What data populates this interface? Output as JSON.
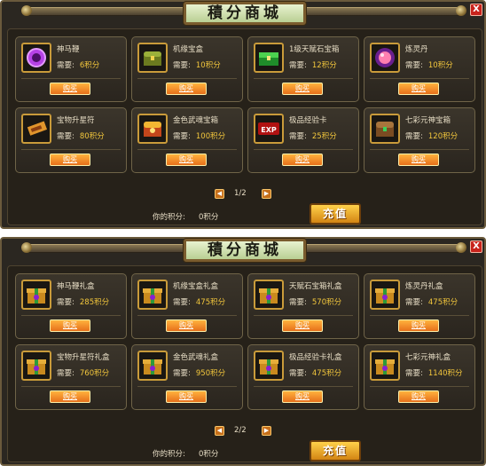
{
  "panels": [
    {
      "title": "積分商城",
      "close_label": "X",
      "items": [
        {
          "name": "神马鞭",
          "cost_label": "需要:",
          "cost": "6积分",
          "buy": "购买",
          "icon": "purple-ring-icon"
        },
        {
          "name": "机缘宝盒",
          "cost_label": "需要:",
          "cost": "10积分",
          "buy": "购买",
          "icon": "treasure-chest-icon"
        },
        {
          "name": "1级天赋石宝箱",
          "cost_label": "需要:",
          "cost": "12积分",
          "buy": "购买",
          "icon": "green-chest-icon"
        },
        {
          "name": "炼灵丹",
          "cost_label": "需要:",
          "cost": "10积分",
          "buy": "购买",
          "icon": "pink-pill-icon"
        },
        {
          "name": "宝物升星符",
          "cost_label": "需要:",
          "cost": "80积分",
          "buy": "购买",
          "icon": "talisman-icon"
        },
        {
          "name": "金色武魂宝箱",
          "cost_label": "需要:",
          "cost": "100积分",
          "buy": "购买",
          "icon": "gold-chest-icon"
        },
        {
          "name": "极品经验卡",
          "cost_label": "需要:",
          "cost": "25积分",
          "buy": "购买",
          "icon": "exp-card-icon"
        },
        {
          "name": "七彩元神宝箱",
          "cost_label": "需要:",
          "cost": "120积分",
          "buy": "购买",
          "icon": "wooden-chest-icon"
        }
      ],
      "pager": {
        "prev": "◀",
        "next": "▶",
        "text": "1/2"
      },
      "points_label": "你的积分:",
      "points_value": "0积分",
      "recharge": "充值"
    },
    {
      "title": "積分商城",
      "close_label": "X",
      "items": [
        {
          "name": "神马鞭礼盒",
          "cost_label": "需要:",
          "cost": "285积分",
          "buy": "购买",
          "icon": "gift-box-icon"
        },
        {
          "name": "机缘宝盒礼盒",
          "cost_label": "需要:",
          "cost": "475积分",
          "buy": "购买",
          "icon": "gift-box-icon"
        },
        {
          "name": "天赋石宝箱礼盒",
          "cost_label": "需要:",
          "cost": "570积分",
          "buy": "购买",
          "icon": "gift-box-icon"
        },
        {
          "name": "炼灵丹礼盒",
          "cost_label": "需要:",
          "cost": "475积分",
          "buy": "购买",
          "icon": "gift-box-icon"
        },
        {
          "name": "宝物升星符礼盒",
          "cost_label": "需要:",
          "cost": "760积分",
          "buy": "购买",
          "icon": "gift-box-icon"
        },
        {
          "name": "金色武魂礼盒",
          "cost_label": "需要:",
          "cost": "950积分",
          "buy": "购买",
          "icon": "gift-box-icon"
        },
        {
          "name": "极品经验卡礼盒",
          "cost_label": "需要:",
          "cost": "475积分",
          "buy": "购买",
          "icon": "gift-box-icon"
        },
        {
          "name": "七彩元神礼盒",
          "cost_label": "需要:",
          "cost": "1140积分",
          "buy": "购买",
          "icon": "gift-box-icon"
        }
      ],
      "pager": {
        "prev": "◀",
        "next": "▶",
        "text": "2/2"
      },
      "points_label": "你的积分:",
      "points_value": "0积分",
      "recharge": "充值"
    }
  ]
}
